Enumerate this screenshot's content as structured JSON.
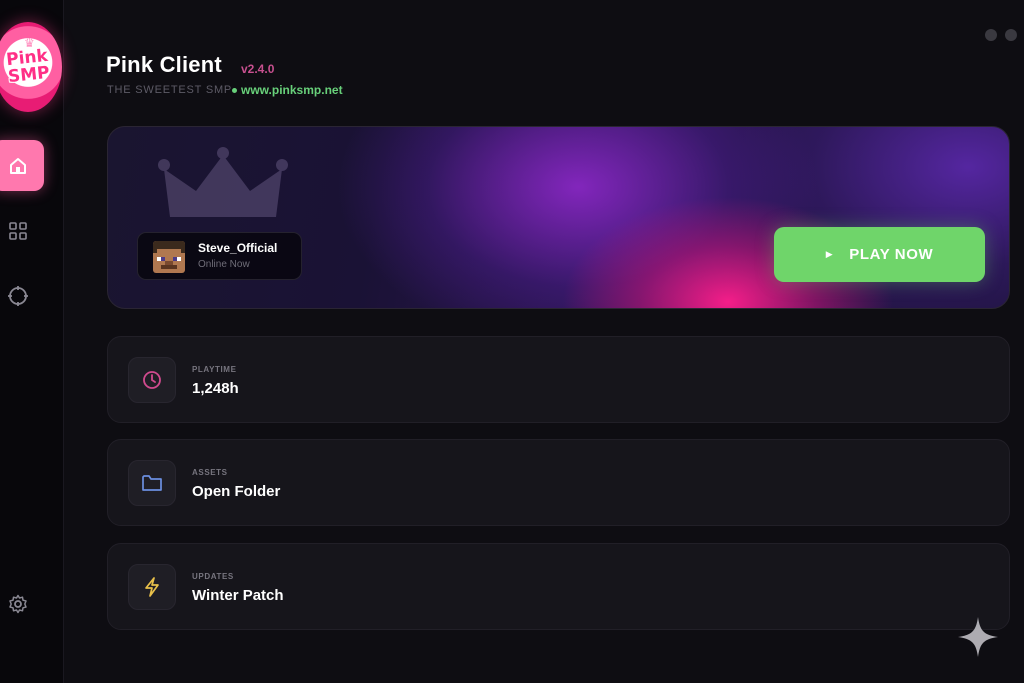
{
  "sidebar": {
    "logo_text": "Pink SMP",
    "items": [
      {
        "name": "home",
        "active": true
      },
      {
        "name": "grid",
        "active": false
      },
      {
        "name": "target",
        "active": false
      }
    ],
    "settings_icon": "gear-icon"
  },
  "header": {
    "title": "Pink Client",
    "version": "v2.4.0",
    "tagline": "THE SWEETEST SMP",
    "website": "www.pinksmp.net"
  },
  "hero": {
    "username": "Steve_Official",
    "status": "Online Now",
    "play_label": "PLAY NOW"
  },
  "cards": [
    {
      "label": "PLAYTIME",
      "value": "1,248h",
      "icon": "clock-icon",
      "icon_color": "#d04a8e"
    },
    {
      "label": "ASSETS",
      "value": "Open Folder",
      "icon": "folder-icon",
      "icon_color": "#6b8fe0"
    },
    {
      "label": "UPDATES",
      "value": "Winter Patch",
      "icon": "lightning-icon",
      "icon_color": "#e8c04a"
    }
  ],
  "colors": {
    "accent_pink": "#ff78ae",
    "play_green": "#6fd56a",
    "link_green": "#68d07a",
    "version_pink": "#c7508f"
  }
}
